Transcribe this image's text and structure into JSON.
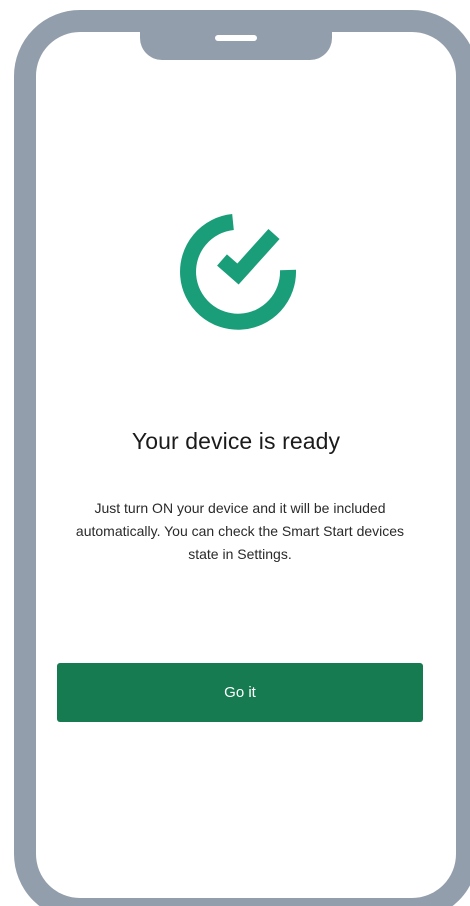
{
  "screen": {
    "icon": "check-circle-icon",
    "title": "Your device is ready",
    "message": "Just turn ON your device and it will be included automatically. You can check the Smart Start devices state in Settings.",
    "primary_button_label": "Go it"
  },
  "colors": {
    "icon_green": "#1a9e7a",
    "button_green": "#167b51",
    "frame_gray": "#929eab"
  }
}
